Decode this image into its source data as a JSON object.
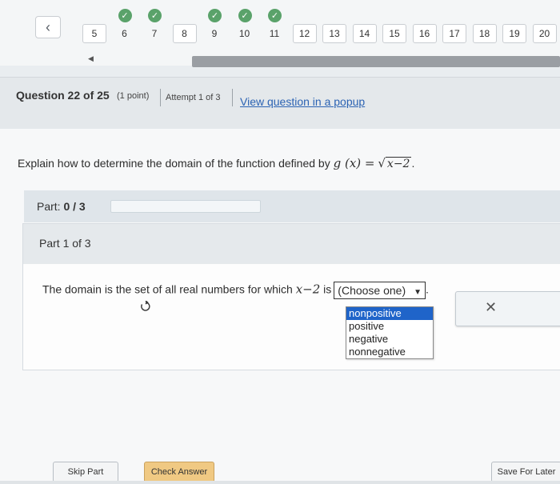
{
  "nav": {
    "questions": [
      {
        "label": "5",
        "done": false
      },
      {
        "label": "6",
        "done": true
      },
      {
        "label": "7",
        "done": true
      },
      {
        "label": "8",
        "done": false
      },
      {
        "label": "9",
        "done": true
      },
      {
        "label": "10",
        "done": true
      },
      {
        "label": "11",
        "done": true
      },
      {
        "label": "12",
        "done": false
      },
      {
        "label": "13",
        "done": false
      },
      {
        "label": "14",
        "done": false
      },
      {
        "label": "15",
        "done": false
      },
      {
        "label": "16",
        "done": false
      },
      {
        "label": "17",
        "done": false
      },
      {
        "label": "18",
        "done": false
      },
      {
        "label": "19",
        "done": false
      },
      {
        "label": "20",
        "done": false
      }
    ]
  },
  "header": {
    "title": "Question 22 of 25",
    "points": "(1 point)",
    "attempt": "Attempt 1 of 3",
    "popup_link": "View question in a popup"
  },
  "prompt": {
    "text": "Explain how to determine the domain of the function defined by",
    "func": "g (x) =",
    "radicand": "x−2",
    "end": "."
  },
  "part_progress": {
    "label": "Part:",
    "value": "0 / 3",
    "fraction": 0
  },
  "part": {
    "title": "Part 1 of 3",
    "answer_prefix": "The domain is the set of all real numbers for which",
    "expr": "x−2",
    "answer_is": "is",
    "select_value": "(Choose one)",
    "options": [
      "nonpositive",
      "positive",
      "negative",
      "nonnegative"
    ]
  },
  "buttons": {
    "skip": "Skip Part",
    "check": "Check Answer",
    "save": "Save For Later"
  }
}
